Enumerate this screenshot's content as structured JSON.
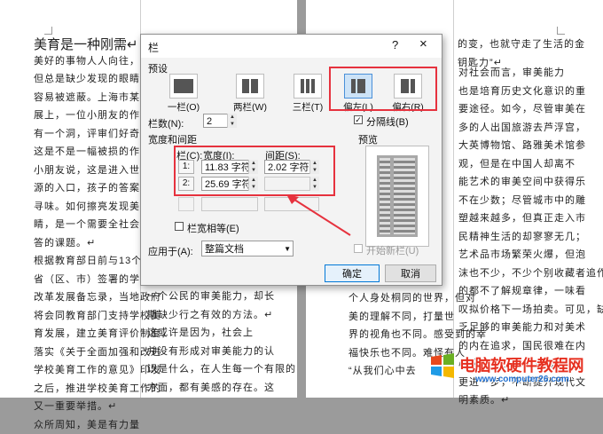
{
  "document": {
    "left_col1": {
      "heading": "美育是一种刚需↵",
      "lines": [
        "美好的事物人人向往，",
        "但总是缺少发现的眼睛，它也",
        "容易被遮蔽。上海市某儿童画",
        "展上，一位小朋友的作品上",
        "有一个洞，评审们好奇地问，",
        "这是不是一幅被损的作品。",
        "小朋友说，这是进入世外桃",
        "源的入口，孩子的答案，耐人",
        "寻味。如何擦亮发现美的眼",
        "睛，是一个需要全社会去回",
        "答的课题。↵",
        "    根据教育部日前与13个",
        "省（区、市）签署的学校美育",
        "改革发展备忘录，当地政府",
        "将会同教育部门支持学校美",
        "育发展，建立美育评价制度，",
        "落实《关于全面加强和改进",
        "学校美育工作的意见》印发",
        "之后，推进学校美育工作的",
        "又一重要举措。↵",
        "    众所周知，美是有力量"
      ]
    },
    "left_col2_fragments": [
      "的",
      "完整",
      "“共",
      "强调",
      "合同",
      "自己",
      "理解",
      "作品",
      "体系",
      "以更",
      "评价"
    ],
    "left_col2_bottom": [
      "一个公民的审美能力，却长",
      "期缺少行之有效的方法。↵",
      "    这或许是因为，社会上",
      "并没有形成对审美能力的认",
      "识是什么，在人生每一个有限的",
      "方面，都有美感的存在。这"
    ],
    "right_col1_top": [
      "的变，也就守走了生活的金",
      "钥匙力”↵"
    ],
    "right_col1_bottom": [
      "个人身处桐同的世界，但对",
      "美的理解不同，打量世",
      "界的视角也不同。感受到的幸",
      "福快乐也不同。难怪有人",
      "“从我们心中去"
    ],
    "right_col2": [
      "    对社会而言，审美能力",
      "也是培育历史文化意识的重",
      "要途径。如今，尽管审美在",
      "多的人出国旅游去芦浮宫，",
      "大英博物馆、路雅美术馆参",
      "观，但是在中国人却离不",
      "能艺术的审美空间中获得乐",
      "不在少数；尽管城市中的雕",
      "塑越来越多，但真正走入市",
      "民精神生活的却寥寥无几；",
      "艺术品市场繁荣火爆，但泡",
      "沫也不少，不少个别收藏者追作",
      "的都不了解规章律，一味看",
      "叹拟价格下一场拍卖。可见，缺",
      "乏足够的审美能力和对美术",
      "的内在追求，国民很难在内",
      "心深处真正树立文化自信，",
      "更进一步，不断提升现代文",
      "明素质。↵"
    ]
  },
  "dialog": {
    "title": "栏",
    "help": "?",
    "close": "×",
    "presets_label": "预设",
    "presets": [
      {
        "label": "一栏(O)",
        "cols": 1
      },
      {
        "label": "两栏(W)",
        "cols": 2
      },
      {
        "label": "三栏(T)",
        "cols": 3
      },
      {
        "label": "偏左(L)",
        "cols": 2,
        "selected": true
      },
      {
        "label": "偏右(R)",
        "cols": 2
      }
    ],
    "num_cols_label": "栏数(N):",
    "num_cols_value": "2",
    "separator_label": "分隔线(B)",
    "width_spacing_label": "宽度和间距",
    "preview_label": "预览",
    "col_header": "栏(C):",
    "width_header": "宽度(I):",
    "spacing_header": "间距(S):",
    "rows": [
      {
        "index": "1:",
        "width": "11.83 字符",
        "spacing": "2.02 字符"
      },
      {
        "index": "2:",
        "width": "25.69 字符",
        "spacing": ""
      }
    ],
    "equal_width_label": "栏宽相等(E)",
    "apply_to_label": "应用于(A):",
    "apply_to_value": "整篇文档",
    "new_column_label": "开始新栏(U)",
    "ok_label": "确定",
    "cancel_label": "取消"
  },
  "watermark": {
    "title": "电脑软硬件教程网",
    "url": "www.computer26.com"
  },
  "colors": {
    "highlight": "#e6323e",
    "selected_preset": "#cde3f7",
    "watermark_red": "#e63020",
    "watermark_blue": "#1f6fd0"
  }
}
